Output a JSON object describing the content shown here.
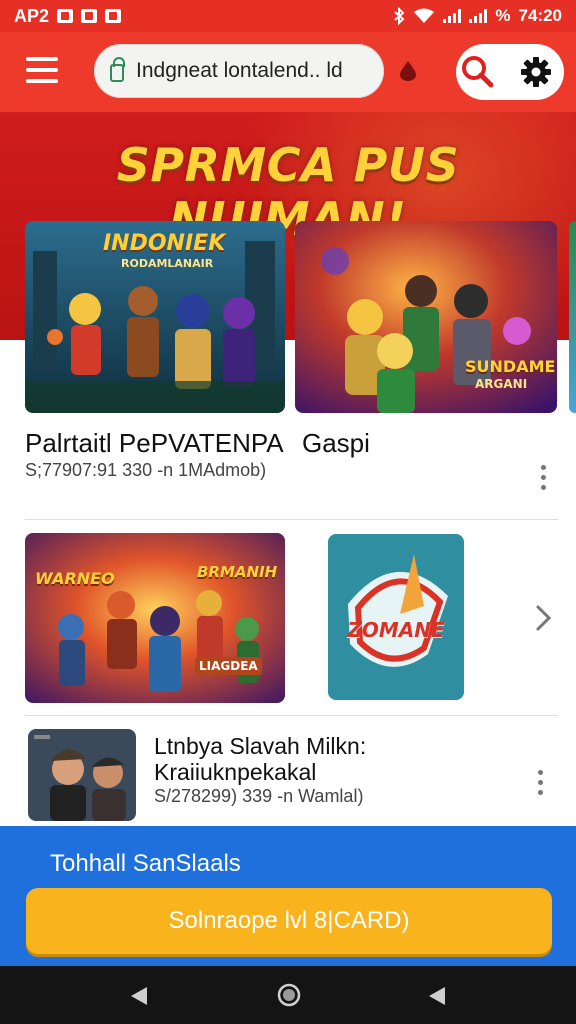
{
  "status_bar": {
    "left_text": "AP2",
    "battery_text": "%",
    "time": "74:20",
    "icons": [
      "mail-icon",
      "play-icon",
      "camera-icon",
      "bluetooth-icon",
      "wifi-icon",
      "signal-icon"
    ]
  },
  "app_bar": {
    "url_text": "Indgneat lontalend.. ld",
    "icons": [
      "menu-icon",
      "lock-icon",
      "drop-icon",
      "search-icon",
      "gear-icon"
    ]
  },
  "hero": {
    "title": "SPRMCA PUS NUIMAN!"
  },
  "cards": [
    {
      "thumb_title": "INDONIEK",
      "thumb_subtitle": "RODAMLANAIR",
      "title": "Palrtaitl PePVATENPA",
      "meta": "S;77907:91 330 -n 1MAdmob)"
    },
    {
      "thumb_title": "SUNDAME",
      "thumb_subtitle": "ARGANI",
      "title": "Gaspi"
    }
  ],
  "row2": {
    "thumb_left_title": "WARNEO",
    "thumb_left_right": "BRMANIH",
    "thumb_left_bottom": "LIAGDEA",
    "thumb_logo": "ZOMANE"
  },
  "row3": {
    "title": "Ltnbya Slavah Milkn: Kraiiuknpekakal",
    "meta": "S/278299) 339 -n Wamlal)"
  },
  "promo": {
    "label": "Tohhall SanSlaals",
    "button_label": "Solnraope lvl 8|CARD)"
  },
  "colors": {
    "status_bar": "#e63025",
    "app_bar": "#ee3a2a",
    "hero": "#c81a1a",
    "hero_title": "#ffd23a",
    "promo": "#1f6fdc",
    "promo_button": "#f8b31d",
    "nav_bar": "#141414"
  }
}
